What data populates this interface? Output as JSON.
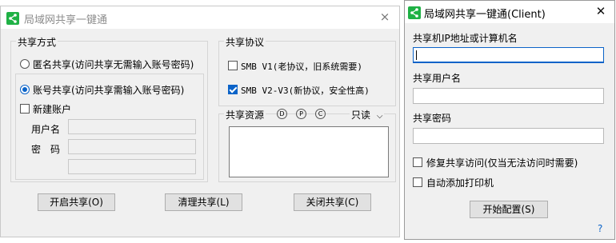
{
  "main_window": {
    "title": "局域网共享一键通",
    "close_glyph": "×",
    "share_mode": {
      "legend": "共享方式",
      "anonymous_label": "匿名共享(访问共享无需输入账号密码)",
      "account_label": "账号共享(访问共享需输入账号密码)",
      "new_account_label": "新建账户",
      "username_label": "用户名",
      "password_label": "密　码"
    },
    "protocol": {
      "legend": "共享协议",
      "smb_v1_label": "SMB V1(老协议，旧系统需要)",
      "smb_v2_label": "SMB V2-V3(新协议，安全性高)"
    },
    "resources": {
      "legend": "共享资源",
      "drive_d": "D",
      "drive_p": "P",
      "drive_c": "C",
      "permission": "只读",
      "dropdown_glyph": "⌵"
    },
    "buttons": {
      "start": "开启共享(O)",
      "clear": "清理共享(L)",
      "stop": "关闭共享(C)"
    }
  },
  "client_window": {
    "title": "局域网共享一键通(Client)",
    "close_glyph": "✕",
    "host_label": "共享机IP地址或计算机名",
    "user_label": "共享用户名",
    "password_label": "共享密码",
    "repair_label": "修复共享访问(仅当无法访问时需要)",
    "printer_label": "自动添加打印机",
    "start_button": "开始配置(S)",
    "help_glyph": "?"
  },
  "colors": {
    "accent": "#0b63c8",
    "icon_green": "#1fb145"
  }
}
